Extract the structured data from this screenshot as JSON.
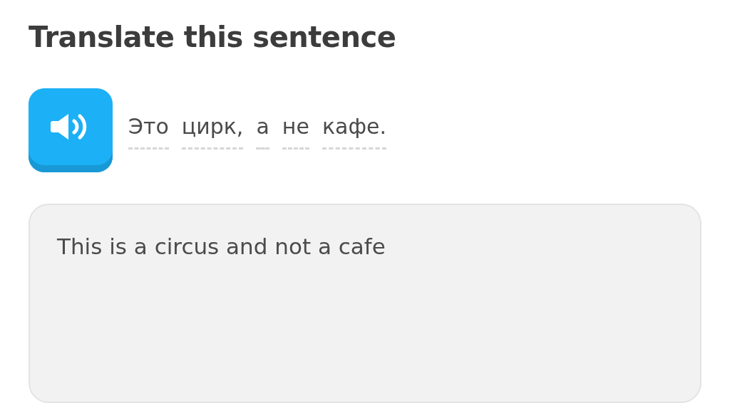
{
  "title": "Translate this sentence",
  "sentence": {
    "words": [
      "Это",
      "цирк,",
      "а",
      "не",
      "кафе."
    ]
  },
  "answer": {
    "value": "This is a circus and not a cafe"
  }
}
